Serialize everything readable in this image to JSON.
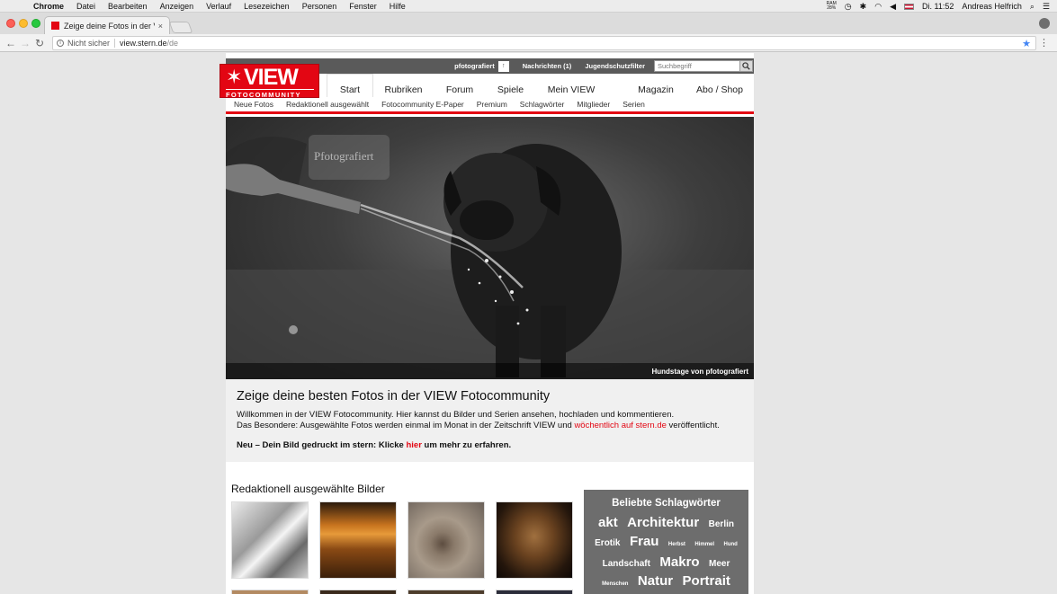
{
  "macos_menubar": {
    "app_name": "Chrome",
    "menus": [
      "Datei",
      "Bearbeiten",
      "Anzeigen",
      "Verlauf",
      "Lesezeichen",
      "Personen",
      "Fenster",
      "Hilfe"
    ],
    "ram_label": "RAM",
    "ram_value": "28%",
    "clock": "Di. 11:52",
    "user": "Andreas Helfrich"
  },
  "browser": {
    "tab_title": "Zeige deine Fotos in der VIEW",
    "tab_close": "×",
    "url_security": "Nicht sicher",
    "url_host": "view.stern.de",
    "url_path": "/de"
  },
  "site": {
    "logo": {
      "view": "VIEW",
      "sub": "FOTOCOMMUNITY"
    },
    "topbar": {
      "user": "pfotografiert",
      "messages": "Nachrichten (1)",
      "youth_filter": "Jugendschutzfilter",
      "search_placeholder": "Suchbegriff"
    },
    "main_nav": [
      "Start",
      "Rubriken",
      "Forum",
      "Spiele",
      "Mein VIEW",
      "Magazin",
      "Abo / Shop"
    ],
    "active_nav": "Start",
    "sub_nav": [
      "Neue Fotos",
      "Redaktionell ausgewählt",
      "Fotocommunity E-Paper",
      "Premium",
      "Schlagwörter",
      "Mitglieder",
      "Serien"
    ],
    "hero": {
      "caption": "Hundstage von pfotografiert",
      "watermark": "Pfotografiert"
    },
    "intro": {
      "title": "Zeige deine besten Fotos in der VIEW Fotocommunity",
      "line1": "Willkommen in der VIEW Fotocommunity. Hier kannst du Bilder und Serien ansehen, hochladen und kommentieren.",
      "line2_prefix": "Das Besondere: Ausgewählte Fotos werden einmal im Monat in der Zeitschrift VIEW und",
      "line2_link": "wöchentlich auf stern.de",
      "line2_suffix": "veröffentlicht.",
      "note_prefix": "Neu – Dein Bild gedruckt im stern: Klicke",
      "note_link": "hier",
      "note_suffix": "um mehr zu erfahren."
    },
    "editorial": {
      "title": "Redaktionell ausgewählte Bilder"
    },
    "tagcloud": {
      "title": "Beliebte Schlagwörter",
      "tags": [
        {
          "label": "akt",
          "size": 15
        },
        {
          "label": "Architektur",
          "size": 15
        },
        {
          "label": "Berlin",
          "size": 10
        },
        {
          "label": "Erotik",
          "size": 10
        },
        {
          "label": "Frau",
          "size": 15
        },
        {
          "label": "Herbst",
          "size": 6
        },
        {
          "label": "Himmel",
          "size": 6
        },
        {
          "label": "Hund",
          "size": 6
        },
        {
          "label": "Landschaft",
          "size": 10
        },
        {
          "label": "Makro",
          "size": 15
        },
        {
          "label": "Meer",
          "size": 10
        },
        {
          "label": "Menschen",
          "size": 6
        },
        {
          "label": "Natur",
          "size": 15
        },
        {
          "label": "Portrait",
          "size": 15
        },
        {
          "label": "Portrait",
          "size": 10
        }
      ]
    }
  },
  "colors": {
    "brand_red": "#e30613",
    "topbar_gray": "#5a5a5a",
    "tagcloud_gray": "#6d6d6d"
  }
}
